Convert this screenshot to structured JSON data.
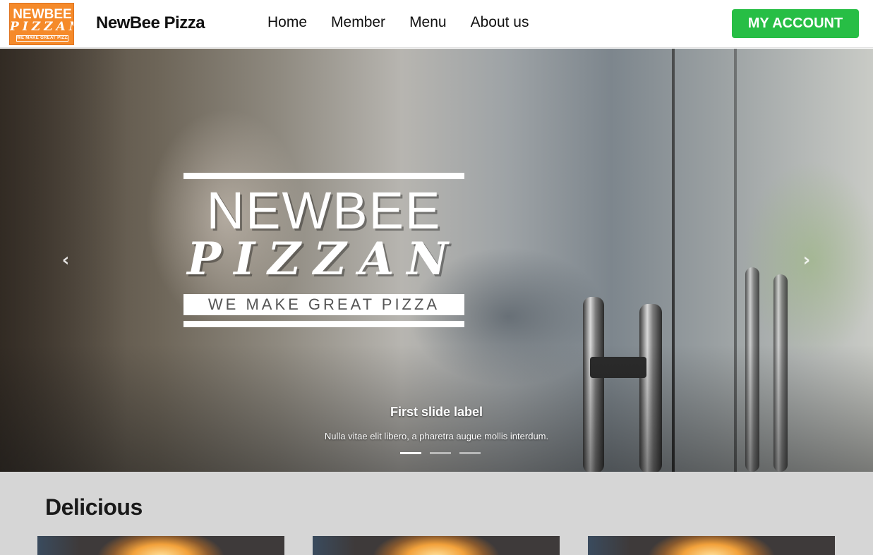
{
  "navbar": {
    "logo": {
      "line1": "NEWBEE",
      "line2": "PIZZAN",
      "line3": "WE MAKE GREAT PIZZA"
    },
    "brand": "NewBee Pizza",
    "links": [
      {
        "label": "Home"
      },
      {
        "label": "Member"
      },
      {
        "label": "Menu"
      },
      {
        "label": "About us"
      }
    ],
    "account_button": "MY ACCOUNT",
    "account_color": "#27be45"
  },
  "carousel": {
    "slide_logo": {
      "line1": "NEWBEE",
      "line2": "PIZZAN",
      "tagline": "WE MAKE GREAT PIZZA"
    },
    "prev_icon": "chevron-left-icon",
    "next_icon": "chevron-right-icon",
    "caption_title": "First slide label",
    "caption_text": "Nulla vitae elit libero, a pharetra augue mollis interdum.",
    "active_slide": 1,
    "slide_count": 3
  },
  "section": {
    "title": "Delicious",
    "cards": 3
  }
}
